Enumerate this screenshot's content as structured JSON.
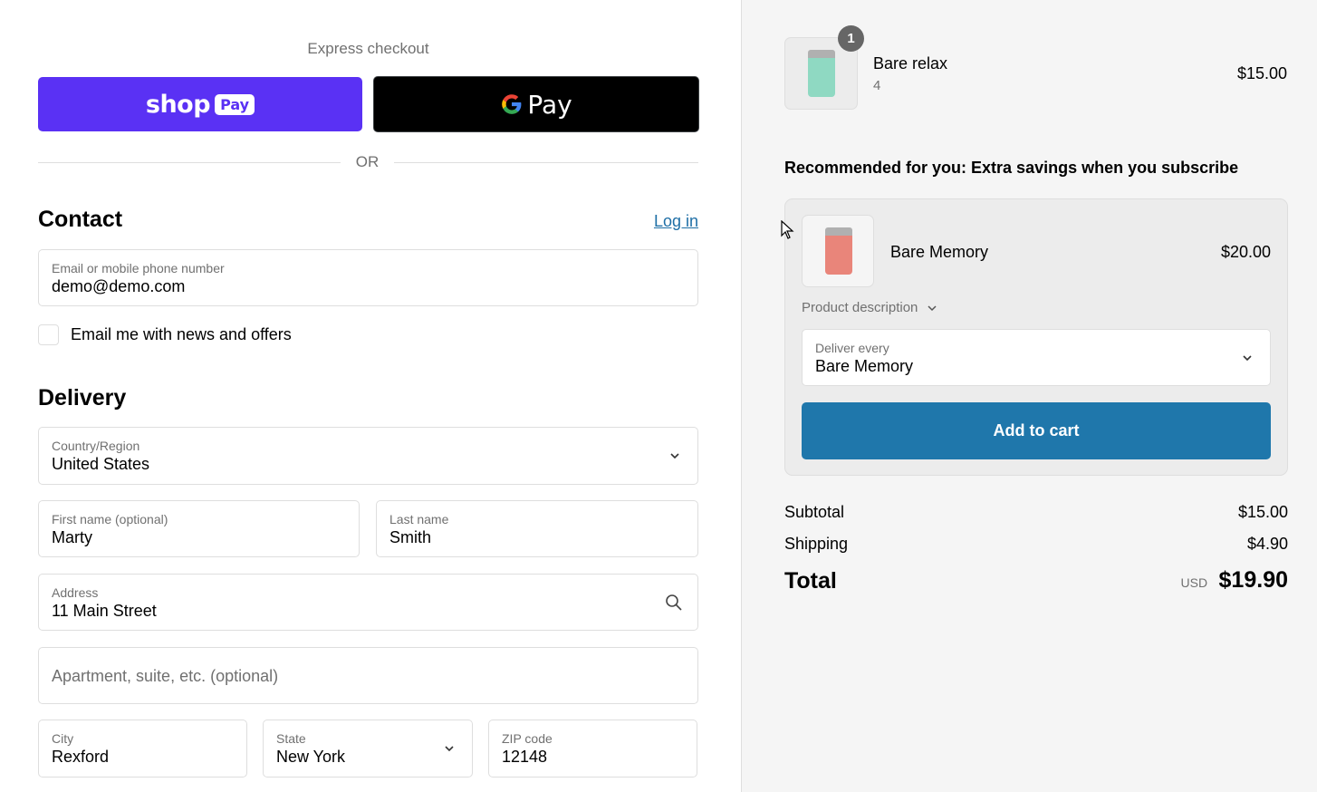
{
  "express": {
    "title": "Express checkout",
    "shop_pay_word": "shop",
    "shop_pay_pill": "Pay",
    "gpay_label": "Pay",
    "or_label": "OR"
  },
  "contact": {
    "title": "Contact",
    "login_label": "Log in",
    "email_label": "Email or mobile phone number",
    "email_value": "demo@demo.com",
    "news_label": "Email me with news and offers"
  },
  "delivery": {
    "title": "Delivery",
    "country_label": "Country/Region",
    "country_value": "United States",
    "first_label": "First name (optional)",
    "first_value": "Marty",
    "last_label": "Last name",
    "last_value": "Smith",
    "address_label": "Address",
    "address_value": "11 Main Street",
    "apt_placeholder": "Apartment, suite, etc. (optional)",
    "city_label": "City",
    "city_value": "Rexford",
    "state_label": "State",
    "state_value": "New York",
    "zip_label": "ZIP code",
    "zip_value": "12148"
  },
  "cart": {
    "item": {
      "name": "Bare relax",
      "qty": "4",
      "badge": "1",
      "price": "$15.00"
    }
  },
  "recommend": {
    "title": "Recommended for you: Extra savings when you subscribe",
    "name": "Bare Memory",
    "price": "$20.00",
    "desc_label": "Product description",
    "deliver_label": "Deliver every",
    "deliver_value": "Bare Memory",
    "add_label": "Add to cart"
  },
  "summary": {
    "subtotal_label": "Subtotal",
    "subtotal_value": "$15.00",
    "shipping_label": "Shipping",
    "shipping_value": "$4.90",
    "total_label": "Total",
    "currency": "USD",
    "total_value": "$19.90"
  },
  "colors": {
    "shop_pay": "#5a31f4",
    "accent_button": "#1f77ab",
    "link": "#1f6fa6"
  }
}
